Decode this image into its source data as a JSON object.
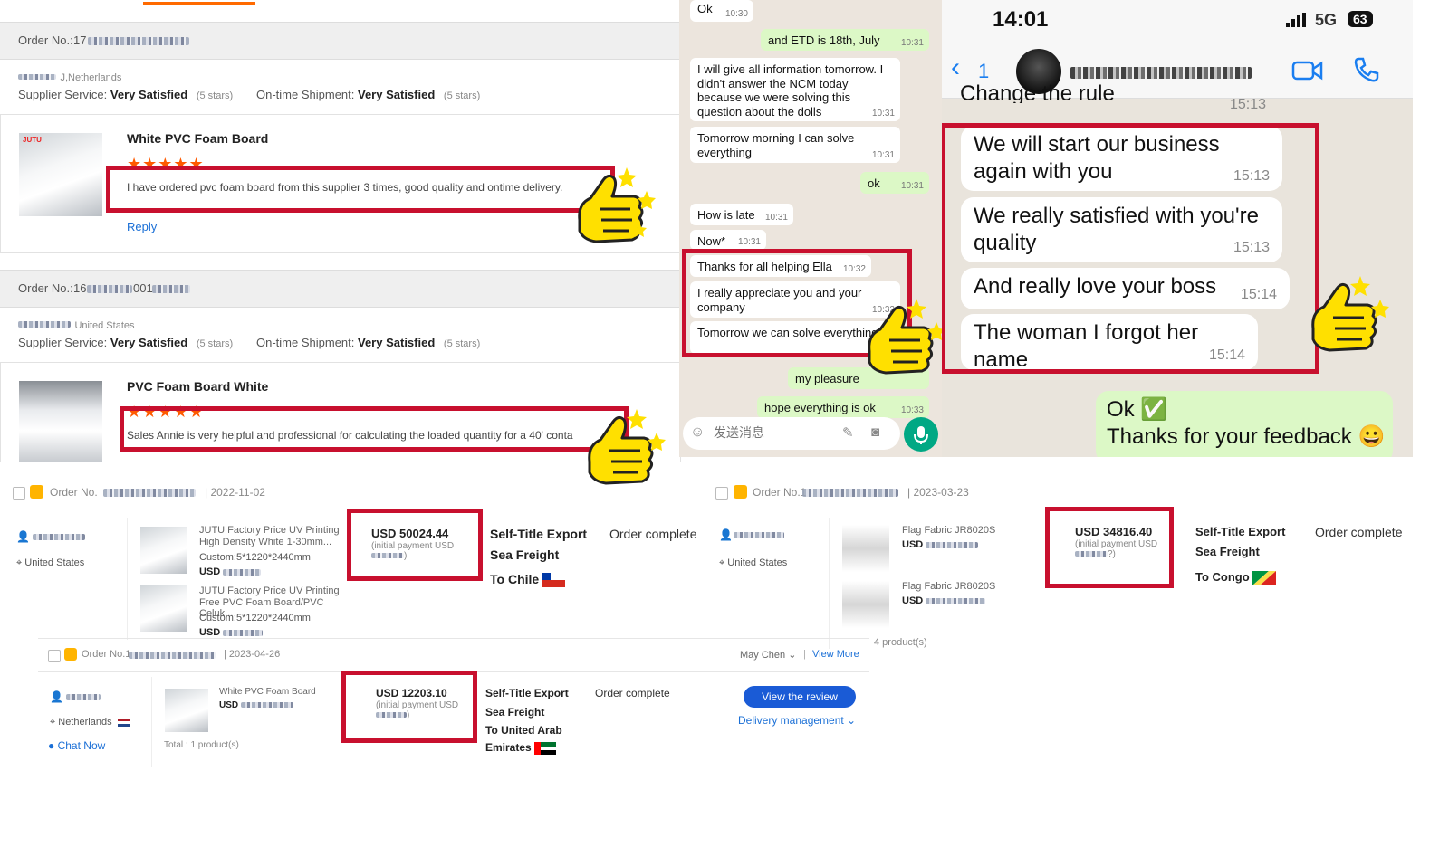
{
  "reviews": {
    "tab_underline": "#ff6a00",
    "r1": {
      "order_label": "Order No.:",
      "order_prefix": "17",
      "buyer_country": "J,Netherlands",
      "supplier_service_label": "Supplier Service:",
      "supplier_service_value": "Very Satisfied",
      "supplier_service_stars": "(5 stars)",
      "shipment_label": "On-time Shipment:",
      "shipment_value": "Very Satisfied",
      "shipment_stars": "(5 stars)",
      "product": "White PVC Foam Board",
      "stars": "★★★★★",
      "text": "I have ordered pvc foam board from this supplier 3 times, good quality and ontime delivery.",
      "reply": "Reply"
    },
    "r2": {
      "order_label": "Order No.:",
      "order_prefix": "16",
      "order_mid": "001",
      "buyer_country": "United States",
      "supplier_service_label": "Supplier Service:",
      "supplier_service_value": "Very Satisfied",
      "supplier_service_stars": "(5 stars)",
      "shipment_label": "On-time Shipment:",
      "shipment_value": "Very Satisfied",
      "shipment_stars": "(5 stars)",
      "product": "PVC Foam Board White",
      "stars": "★★★★★",
      "text": "Sales Annie is very helpful and professional for calculating the loaded quantity for a 40' conta"
    }
  },
  "chat": {
    "m0": {
      "text": "Ok",
      "time": "10:30"
    },
    "m1": {
      "text": "and ETD is 18th, July",
      "time": "10:31"
    },
    "m2": {
      "text": "I will give all information tomorrow. I didn't answer the NCM today because we were solving this question about the dolls",
      "time": "10:31"
    },
    "m3": {
      "text": "Tomorrow morning I can solve everything",
      "time": "10:31"
    },
    "m4": {
      "text": "ok",
      "time": "10:31"
    },
    "m5": {
      "text": "How is late",
      "time": "10:31"
    },
    "m6": {
      "text": "Now*",
      "time": "10:31"
    },
    "m7": {
      "text": "Thanks for all helping Ella",
      "time": "10:32"
    },
    "m8": {
      "text": "I really appreciate you and your company",
      "time": "10:32"
    },
    "m9": {
      "text": "Tomorrow we can solve everything",
      "time": "10"
    },
    "m10": {
      "text": "my pleasure",
      "time": ""
    },
    "m11": {
      "text": "hope everything is ok",
      "time": "10:33"
    },
    "input_placeholder": "发送消息"
  },
  "phone": {
    "clock": "14:01",
    "network": "5G",
    "battery": "63",
    "back_count": "1",
    "prev_text": "Change the rule",
    "prev_time": "15:13",
    "b1": {
      "text": "We will start our business again with you",
      "time": "15:13"
    },
    "b2": {
      "text": "We really satisfied with you're quality",
      "time": "15:13"
    },
    "b3": {
      "text": "And really love your boss",
      "time": "15:14"
    },
    "b4": {
      "text": "The woman I forgot her name",
      "time": "15:14"
    },
    "reply_line1": "Ok ✅",
    "reply_line2": "Thanks for your feedback 😀"
  },
  "orders": {
    "o1": {
      "order_label": "Order No.",
      "date": "| 2022-11-02",
      "country": "United States",
      "p1_title": "JUTU Factory Price UV Printing High Density White 1-30mm...",
      "p1_custom": "Custom:5*1220*2440mm",
      "p2_title": "JUTU Factory Price UV Printing Free PVC Foam Board/PVC Celuk...",
      "p2_custom": "Custom:5*1220*2440mm",
      "usd": "USD",
      "amount": "USD 50024.44",
      "amount_note": "(initial payment USD",
      "amount_note_end": ")",
      "export": "Self-Title Export",
      "shipping": "Sea Freight",
      "to": "To Chile",
      "status": "Order complete"
    },
    "o2": {
      "order_label": "Order No.1",
      "date": "| 2023-03-23",
      "country": "United States",
      "p1_title": "Flag Fabric JR8020S",
      "p2_title": "Flag Fabric JR8020S",
      "usd": "USD",
      "products": "4 product(s)",
      "amount": "USD 34816.40",
      "amount_note": "(initial payment USD",
      "amount_note_end": "?)",
      "export": "Self-Title Export",
      "shipping": "Sea Freight",
      "to": "To Congo",
      "status": "Order complete"
    },
    "o3": {
      "order_label": "Order No.1",
      "date": "| 2023-04-26",
      "seller": "May Chen",
      "view_more": "View More",
      "country": "Netherlands",
      "chat_now": "Chat Now",
      "p1_title": "White PVC Foam Board",
      "usd": "USD",
      "total": "Total : 1 product(s)",
      "amount": "USD 12203.10",
      "amount_note": "(initial payment USD",
      "amount_note_end": ")",
      "export": "Self-Title Export",
      "shipping": "Sea Freight",
      "to_line1": "To United Arab",
      "to_line2": "Emirates",
      "status": "Order complete",
      "view_review": "View the review",
      "delivery": "Delivery management"
    }
  },
  "colors": {
    "highlight_red": "#c8102e",
    "star_orange": "#ff5a00",
    "link_blue": "#1a6fd6",
    "chat_bg": "#ece5dd",
    "bubble_out": "#dcf8c6"
  }
}
